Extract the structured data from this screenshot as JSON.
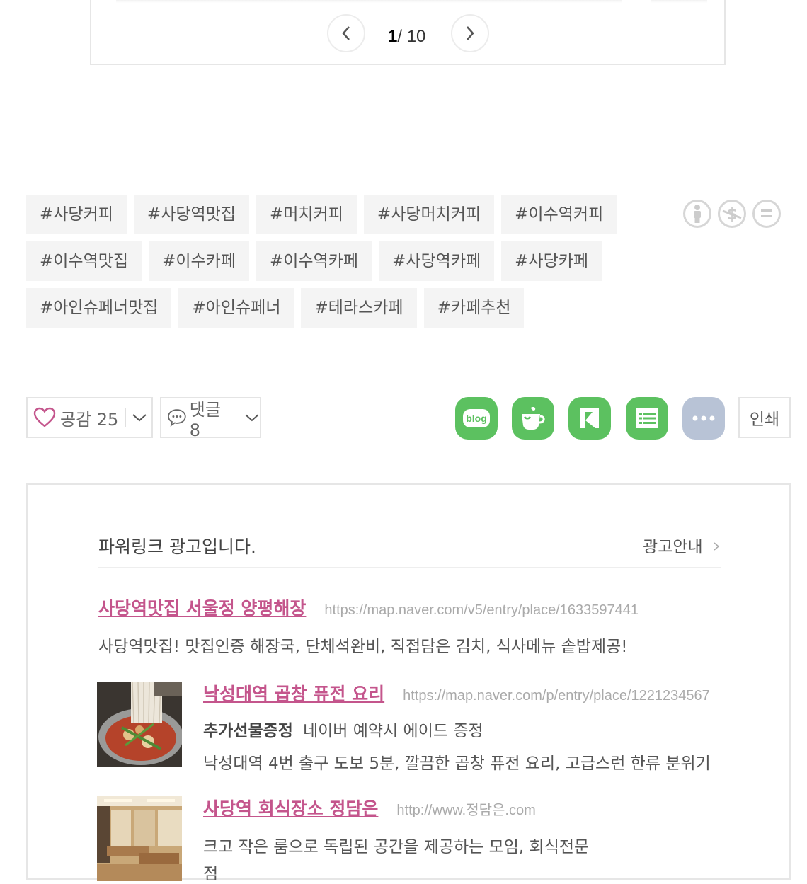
{
  "pager": {
    "current": "1",
    "total": "/ 10"
  },
  "tags": [
    [
      "#사당커피",
      "#사당역맛집",
      "#머치커피",
      "#사당머치커피",
      "#이수역커피"
    ],
    [
      "#이수역맛집",
      "#이수카페",
      "#이수역카페",
      "#사당역카페",
      "#사당카페"
    ],
    [
      "#아인슈페너맛집",
      "#아인슈페너",
      "#테라스카페",
      "#카페추천"
    ]
  ],
  "reactions": {
    "like_label": "공감 25",
    "comment_label": "댓글 8",
    "print_label": "인쇄",
    "blog_label": "blog"
  },
  "colors": {
    "accent_pink": "#c4558c",
    "share_green": "#5cc160",
    "share_more": "#b8c3d6"
  },
  "ads": {
    "header": "파워링크 광고입니다.",
    "guide": "광고안내",
    "items": [
      {
        "title": "사당역맛집 서울정 양평해장",
        "url": "https://map.naver.com/v5/entry/place/1633597441",
        "desc": "사당역맛집! 맛집인증 해장국, 단체석완비, 직접담은 김치, 식사메뉴 솥밥제공!"
      },
      {
        "title": "낙성대역 곱창 퓨전 요리",
        "url": "https://map.naver.com/p/entry/place/1221234567",
        "bold": "추가선물증정",
        "extra": "네이버 예약시 에이드 증정",
        "desc": "낙성대역 4번 출구 도보 5분, 깔끔한 곱창 퓨전 요리, 고급스런 한류 분위기"
      },
      {
        "title": "사당역 회식장소 정담은",
        "url": "http://www.정담은.com",
        "desc": "크고 작은 룸으로 독립된 공간을 제공하는 모임, 회식전문",
        "desc2": "점"
      }
    ]
  }
}
